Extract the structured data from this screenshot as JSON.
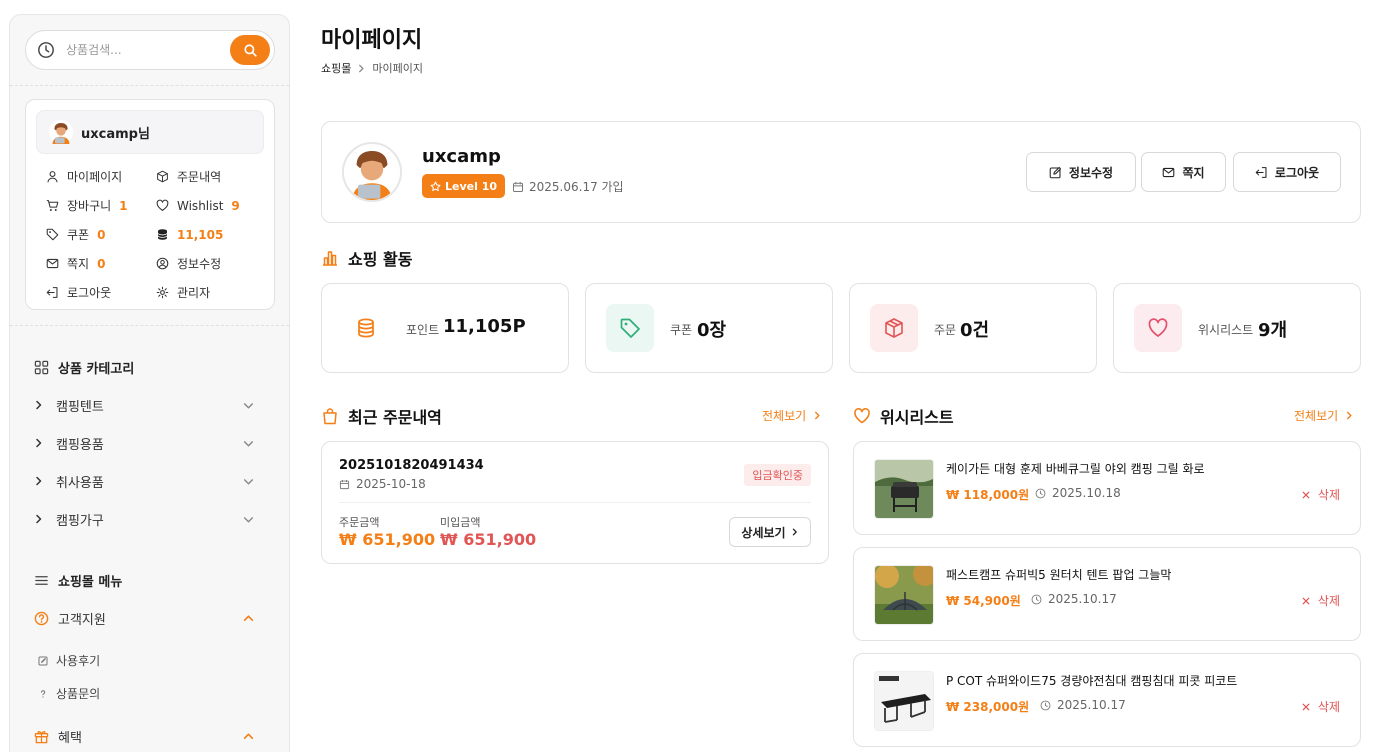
{
  "search": {
    "placeholder": "상품검색..."
  },
  "user": {
    "greeting": "uxcamp님",
    "menu": {
      "mypage": "마이페이지",
      "orders": "주문내역",
      "cart": "장바구니",
      "cart_count": "1",
      "wishlist": "Wishlist",
      "wishlist_count": "9",
      "coupon": "쿠폰",
      "coupon_count": "0",
      "points": "11,105",
      "message": "쪽지",
      "message_count": "0",
      "edit_info": "정보수정",
      "logout": "로그아웃",
      "admin": "관리자"
    }
  },
  "categories": {
    "title": "상품 카테고리",
    "items": [
      "캠핑텐트",
      "캠핑용품",
      "취사용품",
      "캠핑가구"
    ]
  },
  "shop_menu": {
    "title": "쇼핑몰 메뉴",
    "support": {
      "label": "고객지원",
      "sub": [
        "사용후기",
        "상품문의"
      ]
    },
    "benefit": {
      "label": "혜택"
    }
  },
  "page": {
    "title": "마이페이지",
    "breadcrumb": {
      "home": "쇼핑몰",
      "current": "마이페이지"
    }
  },
  "profile": {
    "name": "uxcamp",
    "level": "Level 10",
    "joined": "2025.06.17 가입",
    "buttons": {
      "edit": "정보수정",
      "message": "쪽지",
      "logout": "로그아웃"
    }
  },
  "activity": {
    "title": "쇼핑 활동",
    "stats": [
      {
        "label": "포인트",
        "value": "11,105P"
      },
      {
        "label": "쿠폰",
        "value": "0장"
      },
      {
        "label": "주문",
        "value": "0건"
      },
      {
        "label": "위시리스트",
        "value": "9개"
      }
    ]
  },
  "recent_orders": {
    "title": "최근 주문내역",
    "view_all": "전체보기",
    "order": {
      "number": "2025101820491434",
      "date": "2025-10-18",
      "status": "입금확인중",
      "order_amount_label": "주문금액",
      "order_amount": "₩ 651,900",
      "unpaid_label": "미입금액",
      "unpaid_amount": "₩ 651,900",
      "detail_button": "상세보기"
    }
  },
  "wishlist": {
    "title": "위시리스트",
    "view_all": "전체보기",
    "delete_label": "삭제",
    "items": [
      {
        "name": "케이가든 대형 훈제 바베큐그릴 야외 캠핑 그릴 화로",
        "price": "₩ 118,000원",
        "date": "2025.10.18"
      },
      {
        "name": "패스트캠프 슈퍼빅5 원터치 텐트 팝업 그늘막",
        "price": "₩ 54,900원",
        "date": "2025.10.17"
      },
      {
        "name": "P COT 슈퍼와이드75 경량야전침대 캠핑침대 피콧 피코트",
        "price": "₩ 238,000원",
        "date": "2025.10.17"
      }
    ]
  },
  "colors": {
    "accent": "#f47f16",
    "danger": "#e25555"
  }
}
